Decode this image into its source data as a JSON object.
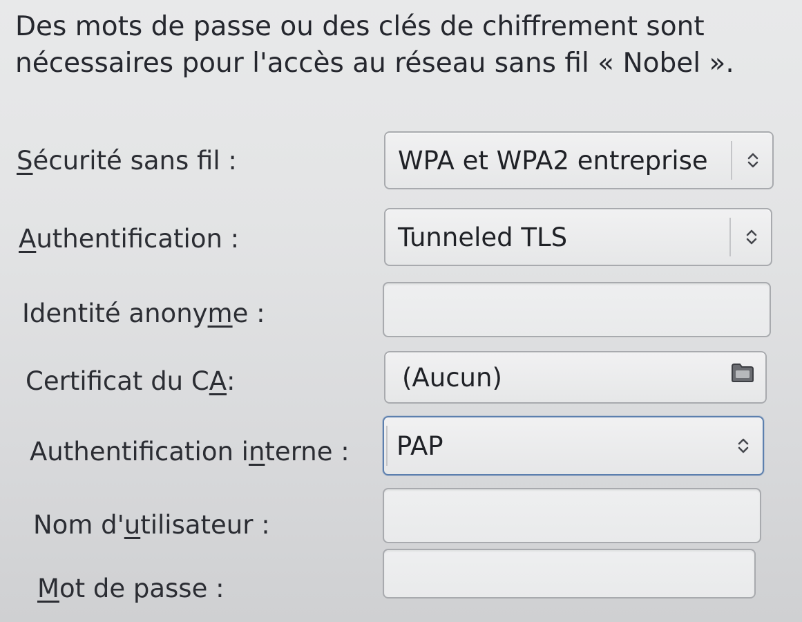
{
  "message": {
    "line1": "Des mots de passe ou des clés de chiffrement sont",
    "line2": "nécessaires pour l'accès au réseau sans fil « Nobel »."
  },
  "form": {
    "security": {
      "label_before": "",
      "mnemonic": "S",
      "label_after": "écurité sans fil :",
      "value": "WPA et WPA2 entreprise",
      "icon": "combo-updown-arrows-icon"
    },
    "authentication": {
      "label_before": "",
      "mnemonic": "A",
      "label_after": "uthentification :",
      "value": "Tunneled TLS",
      "icon": "combo-updown-arrows-icon"
    },
    "anonymous_identity": {
      "label_before": "Identité anony",
      "mnemonic": "m",
      "label_after": "e :",
      "value": ""
    },
    "ca_certificate": {
      "label_before": "Certificat du C",
      "mnemonic": "A",
      "label_after": " :",
      "value": "(Aucun)",
      "icon": "folder-icon"
    },
    "inner_authentication": {
      "label_before": "Authentification i",
      "mnemonic": "n",
      "label_after": "terne :",
      "value": "PAP",
      "icon": "combo-updown-arrows-icon"
    },
    "username": {
      "label_before": "Nom d'",
      "mnemonic": "u",
      "label_after": "tilisateur :",
      "value": ""
    },
    "password": {
      "label_before": "",
      "mnemonic": "M",
      "label_after": "ot de passe :",
      "value": ""
    }
  },
  "colors": {
    "background": "#e3e4e5",
    "text": "#2b2d33",
    "focus_border": "#5c7fae",
    "control_border": "#a8aaae"
  }
}
